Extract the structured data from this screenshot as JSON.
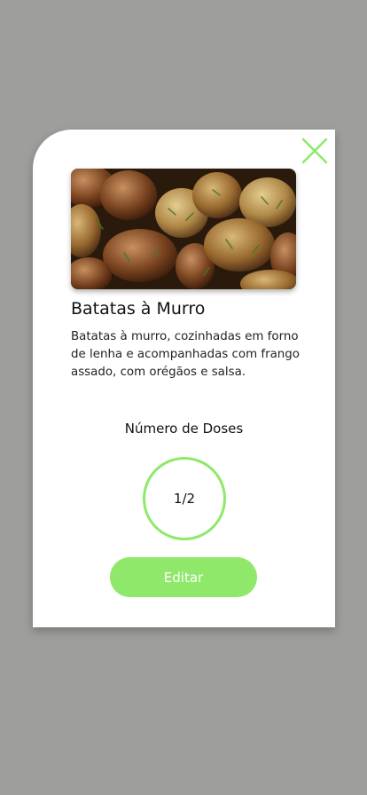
{
  "recipe": {
    "title": "Batatas à Murro",
    "description": "Batatas à murro, cozinhadas em forno de lenha e acompanhadas com frango assado, com orégãos e salsa.",
    "image_icon": "food-photo"
  },
  "doses": {
    "label": "Número de Doses",
    "value": "1/2"
  },
  "actions": {
    "edit_label": "Editar",
    "close_icon": "close-icon"
  },
  "colors": {
    "accent": "#8fe86a",
    "backdrop": "#9e9e9c",
    "card": "#ffffff"
  }
}
